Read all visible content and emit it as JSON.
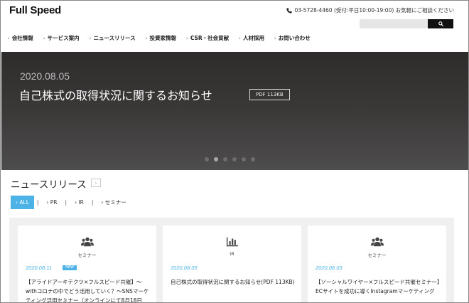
{
  "header": {
    "logo": "Full Speed",
    "contact": "03-5728-4460 (受付:平日10:00-19:00) お気軽にご相談ください",
    "search_placeholder": ""
  },
  "nav": [
    {
      "label": "会社情報"
    },
    {
      "label": "サービス案内"
    },
    {
      "label": "ニュースリリース"
    },
    {
      "label": "投資家情報"
    },
    {
      "label": "CSR・社会貢献"
    },
    {
      "label": "人材採用"
    },
    {
      "label": "お問い合わせ"
    }
  ],
  "hero": {
    "date": "2020.08.05",
    "title": "自己株式の取得状況に関するお知らせ",
    "badge": "PDF 113KB",
    "slide_count": 6,
    "active_slide": 2
  },
  "news": {
    "title": "ニュースリリース",
    "more": "›",
    "filters": [
      {
        "label": "› ALL",
        "active": true
      },
      {
        "label": "› PR",
        "active": false
      },
      {
        "label": "› IR",
        "active": false
      },
      {
        "label": "› セミナー",
        "active": false
      }
    ],
    "cards": [
      {
        "icon": "people-icon",
        "category": "セミナー",
        "date": "2020.08.11",
        "new_label": "NEW",
        "text": "【アライドアーキテクツ×フルスピード共催】～withコロナの中でどう活用していく？～SNSマーケティング活用セミナー（オンラインにて8月18日"
      },
      {
        "icon": "bar-chart-icon",
        "category": "IR",
        "date": "2020.08.05",
        "new_label": "",
        "text": "自己株式の取得状況に関するお知らせ(PDF 113KB)"
      },
      {
        "icon": "people-icon",
        "category": "セミナー",
        "date": "2020.08.03",
        "new_label": "",
        "text": "【ソーシャルワイヤー×フルスピード共催セミナー】ECサイトを成功に導くInstagramマーケティング"
      }
    ]
  },
  "colors": {
    "accent": "#4db3e6",
    "hero_bg": "#3b3938"
  }
}
